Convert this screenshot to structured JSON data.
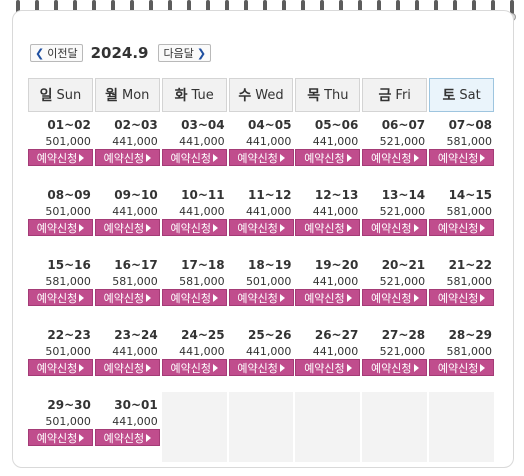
{
  "nav": {
    "prev_label": "이전달",
    "month_title": "2024.9",
    "next_label": "다음달"
  },
  "headers": [
    {
      "ko": "일",
      "en": "Sun"
    },
    {
      "ko": "월",
      "en": "Mon"
    },
    {
      "ko": "화",
      "en": "Tue"
    },
    {
      "ko": "수",
      "en": "Wed"
    },
    {
      "ko": "목",
      "en": "Thu"
    },
    {
      "ko": "금",
      "en": "Fri"
    },
    {
      "ko": "토",
      "en": "Sat"
    }
  ],
  "reserve_label": "예약신청",
  "weeks": [
    [
      {
        "dates": "01~02",
        "price": "501,000"
      },
      {
        "dates": "02~03",
        "price": "441,000"
      },
      {
        "dates": "03~04",
        "price": "441,000"
      },
      {
        "dates": "04~05",
        "price": "441,000"
      },
      {
        "dates": "05~06",
        "price": "441,000"
      },
      {
        "dates": "06~07",
        "price": "521,000"
      },
      {
        "dates": "07~08",
        "price": "581,000"
      }
    ],
    [
      {
        "dates": "08~09",
        "price": "501,000"
      },
      {
        "dates": "09~10",
        "price": "441,000"
      },
      {
        "dates": "10~11",
        "price": "441,000"
      },
      {
        "dates": "11~12",
        "price": "441,000"
      },
      {
        "dates": "12~13",
        "price": "441,000"
      },
      {
        "dates": "13~14",
        "price": "521,000"
      },
      {
        "dates": "14~15",
        "price": "581,000"
      }
    ],
    [
      {
        "dates": "15~16",
        "price": "581,000"
      },
      {
        "dates": "16~17",
        "price": "581,000"
      },
      {
        "dates": "17~18",
        "price": "581,000"
      },
      {
        "dates": "18~19",
        "price": "501,000"
      },
      {
        "dates": "19~20",
        "price": "441,000"
      },
      {
        "dates": "20~21",
        "price": "521,000"
      },
      {
        "dates": "21~22",
        "price": "581,000"
      }
    ],
    [
      {
        "dates": "22~23",
        "price": "501,000"
      },
      {
        "dates": "23~24",
        "price": "441,000"
      },
      {
        "dates": "24~25",
        "price": "441,000"
      },
      {
        "dates": "25~26",
        "price": "441,000"
      },
      {
        "dates": "26~27",
        "price": "441,000"
      },
      {
        "dates": "27~28",
        "price": "521,000"
      },
      {
        "dates": "28~29",
        "price": "581,000"
      }
    ],
    [
      {
        "dates": "29~30",
        "price": "501,000"
      },
      {
        "dates": "30~01",
        "price": "441,000"
      },
      null,
      null,
      null,
      null,
      null
    ]
  ]
}
